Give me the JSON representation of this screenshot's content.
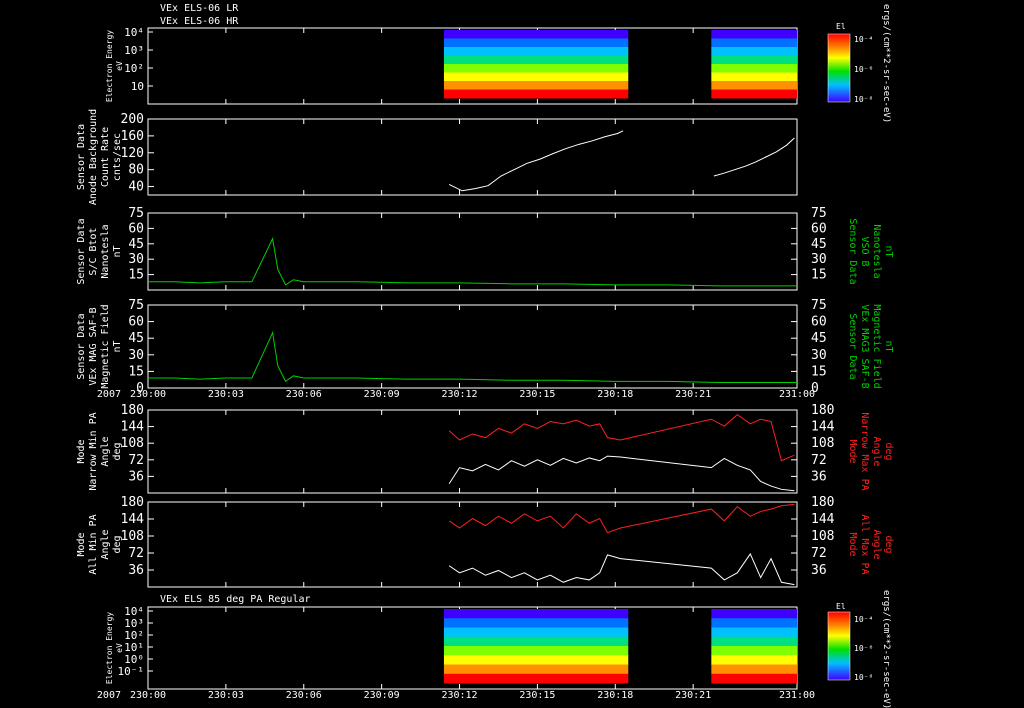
{
  "header": {
    "line1": "VEx ELS-06 LR",
    "line2": "VEx ELS-06 HR"
  },
  "time_axis": {
    "ticks": [
      "230:00",
      "230:03",
      "230:06",
      "230:09",
      "230:12",
      "230:15",
      "230:18",
      "230:21",
      "231:00"
    ],
    "year": "2007"
  },
  "colorbar": {
    "title": "El",
    "ticks": [
      "10⁻⁴",
      "10⁻⁶",
      "10⁻⁸"
    ],
    "unit": "ergs/(cm**2-sr-sec-eV)"
  },
  "chart_data": [
    {
      "type": "heatmap",
      "panel": "electron-spectrogram-top",
      "ylabel": [
        "Electron Energy",
        "eV"
      ],
      "yticks": [
        "10⁴",
        "10³",
        "10²",
        "10"
      ],
      "yscale": "log",
      "xrange": [
        "230:00",
        "231:00"
      ],
      "data_intervals": [
        [
          "230:11.4",
          "230:18.5"
        ],
        [
          "230:21.7",
          "231:00"
        ]
      ],
      "colors": {
        "low": "#2000ff",
        "high": "#ff0000"
      }
    },
    {
      "type": "line",
      "panel": "count-rate",
      "ylabel": [
        "Sensor Data",
        "Anode Background",
        "Count Rate",
        "cnts/sec"
      ],
      "yticks": [
        200,
        160,
        120,
        80,
        40
      ],
      "ylim": [
        20,
        200
      ],
      "color": "#ffffff",
      "series": [
        {
          "x": [
            11.6,
            12.1,
            12.6,
            13.1,
            13.6,
            14.1,
            14.6,
            15.1,
            15.6,
            16.1,
            16.6,
            17.1,
            17.6,
            18.1,
            18.3
          ],
          "y": [
            45,
            30,
            35,
            42,
            65,
            80,
            95,
            105,
            118,
            130,
            140,
            148,
            158,
            166,
            172
          ]
        },
        {
          "x": [
            21.8,
            22.2,
            22.6,
            23.0,
            23.4,
            23.8,
            24.2,
            24.6,
            24.9
          ],
          "y": [
            65,
            72,
            80,
            88,
            98,
            110,
            122,
            138,
            155
          ]
        }
      ]
    },
    {
      "type": "line",
      "panel": "sc-bmag",
      "ylabel": [
        "Sensor Data",
        "S/C Btot",
        "Nanotesla",
        "nT"
      ],
      "ylabel_right": [
        "Sensor Data",
        "VSO B",
        "Nanotesla",
        "nT"
      ],
      "yticks": [
        75,
        60,
        45,
        30,
        15
      ],
      "ylim": [
        0,
        75
      ],
      "color": "#00d000",
      "series": [
        {
          "x": [
            0,
            1,
            2,
            3,
            4,
            4.8,
            5.0,
            5.3,
            5.6,
            6,
            8,
            10,
            12,
            14,
            16,
            18,
            20,
            22,
            25
          ],
          "y": [
            8,
            8,
            7,
            8,
            8,
            50,
            20,
            5,
            10,
            8,
            8,
            7,
            7,
            6,
            6,
            5,
            5,
            4,
            4
          ]
        }
      ]
    },
    {
      "type": "line",
      "panel": "mag-field",
      "ylabel": [
        "Sensor Data",
        "VEx MAG SAF-B",
        "Magnetic Field",
        "nT"
      ],
      "ylabel_right": [
        "Sensor Data",
        "VEx MAG3 SAF-B",
        "Magnetic Field",
        "nT"
      ],
      "yticks": [
        75,
        60,
        45,
        30,
        15,
        0
      ],
      "ylim": [
        0,
        75
      ],
      "color": "#00d000",
      "series": [
        {
          "x": [
            0,
            1,
            2,
            3,
            4,
            4.8,
            5.0,
            5.3,
            5.6,
            6,
            8,
            10,
            12,
            14,
            16,
            18,
            20,
            22,
            25
          ],
          "y": [
            9,
            9,
            8,
            9,
            9,
            50,
            20,
            6,
            11,
            9,
            9,
            8,
            8,
            7,
            7,
            6,
            6,
            5,
            5
          ]
        }
      ]
    },
    {
      "type": "line",
      "panel": "narrow-pa",
      "ylabel": [
        "Mode",
        "Narrow Min PA",
        "Angle",
        "deg"
      ],
      "ylabel_right": [
        "Mode",
        "Narrow Max PA",
        "Angle",
        "deg"
      ],
      "yticks": [
        180,
        144,
        108,
        72,
        36
      ],
      "ylim": [
        0,
        180
      ],
      "series": [
        {
          "name": "Narrow Min PA",
          "color": "#ffffff",
          "x": [
            11.6,
            12.0,
            12.5,
            13.0,
            13.5,
            14.0,
            14.5,
            15.0,
            15.5,
            16.0,
            16.5,
            17.0,
            17.4,
            17.7,
            18.2,
            21.7,
            22.2,
            22.7,
            23.2,
            23.6,
            24.0,
            24.4,
            24.9
          ],
          "y": [
            20,
            55,
            48,
            62,
            50,
            70,
            58,
            72,
            60,
            75,
            65,
            76,
            70,
            80,
            78,
            55,
            75,
            60,
            50,
            25,
            15,
            8,
            5
          ]
        },
        {
          "name": "Narrow Max PA",
          "color": "#ff2020",
          "x": [
            11.6,
            12.0,
            12.5,
            13.0,
            13.5,
            14.0,
            14.5,
            15.0,
            15.5,
            16.0,
            16.5,
            17.0,
            17.4,
            17.7,
            18.2,
            21.7,
            22.2,
            22.7,
            23.2,
            23.6,
            24.0,
            24.4,
            24.9
          ],
          "y": [
            135,
            115,
            128,
            120,
            140,
            130,
            150,
            140,
            155,
            150,
            158,
            145,
            150,
            120,
            115,
            160,
            145,
            170,
            150,
            160,
            155,
            70,
            82
          ]
        }
      ]
    },
    {
      "type": "line",
      "panel": "all-pa",
      "ylabel": [
        "Mode",
        "All Min PA",
        "Angle",
        "deg"
      ],
      "ylabel_right": [
        "Mode",
        "All Max PA",
        "Angle",
        "deg"
      ],
      "yticks": [
        180,
        144,
        108,
        72,
        36
      ],
      "ylim": [
        0,
        180
      ],
      "series": [
        {
          "name": "All Min PA",
          "color": "#ffffff",
          "x": [
            11.6,
            12.0,
            12.5,
            13.0,
            13.5,
            14.0,
            14.5,
            15.0,
            15.5,
            16.0,
            16.5,
            17.0,
            17.4,
            17.7,
            18.2,
            21.7,
            22.2,
            22.7,
            23.2,
            23.6,
            24.0,
            24.4,
            24.9
          ],
          "y": [
            45,
            30,
            40,
            25,
            35,
            20,
            30,
            15,
            25,
            10,
            20,
            15,
            30,
            68,
            60,
            40,
            15,
            30,
            70,
            20,
            60,
            10,
            5
          ]
        },
        {
          "name": "All Max PA",
          "color": "#ff2020",
          "x": [
            11.6,
            12.0,
            12.5,
            13.0,
            13.5,
            14.0,
            14.5,
            15.0,
            15.5,
            16.0,
            16.5,
            17.0,
            17.4,
            17.7,
            18.2,
            21.7,
            22.2,
            22.7,
            23.2,
            23.6,
            24.0,
            24.4,
            24.9
          ],
          "y": [
            140,
            125,
            145,
            130,
            150,
            135,
            155,
            140,
            150,
            125,
            155,
            135,
            145,
            115,
            125,
            165,
            140,
            170,
            150,
            160,
            165,
            172,
            175
          ]
        }
      ]
    },
    {
      "type": "heatmap",
      "panel": "electron-spectrogram-85deg",
      "title": "VEx ELS 85 deg PA Regular",
      "ylabel": [
        "Electron Energy",
        "eV"
      ],
      "yticks": [
        "10⁴",
        "10³",
        "10²",
        "10¹",
        "10⁰",
        "10⁻¹"
      ],
      "yscale": "log",
      "xrange": [
        "230:00",
        "231:00"
      ],
      "data_intervals": [
        [
          "230:11.4",
          "230:18.5"
        ],
        [
          "230:21.7",
          "231:00"
        ]
      ],
      "colors": {
        "low": "#2000ff",
        "high": "#ff0000"
      }
    }
  ]
}
